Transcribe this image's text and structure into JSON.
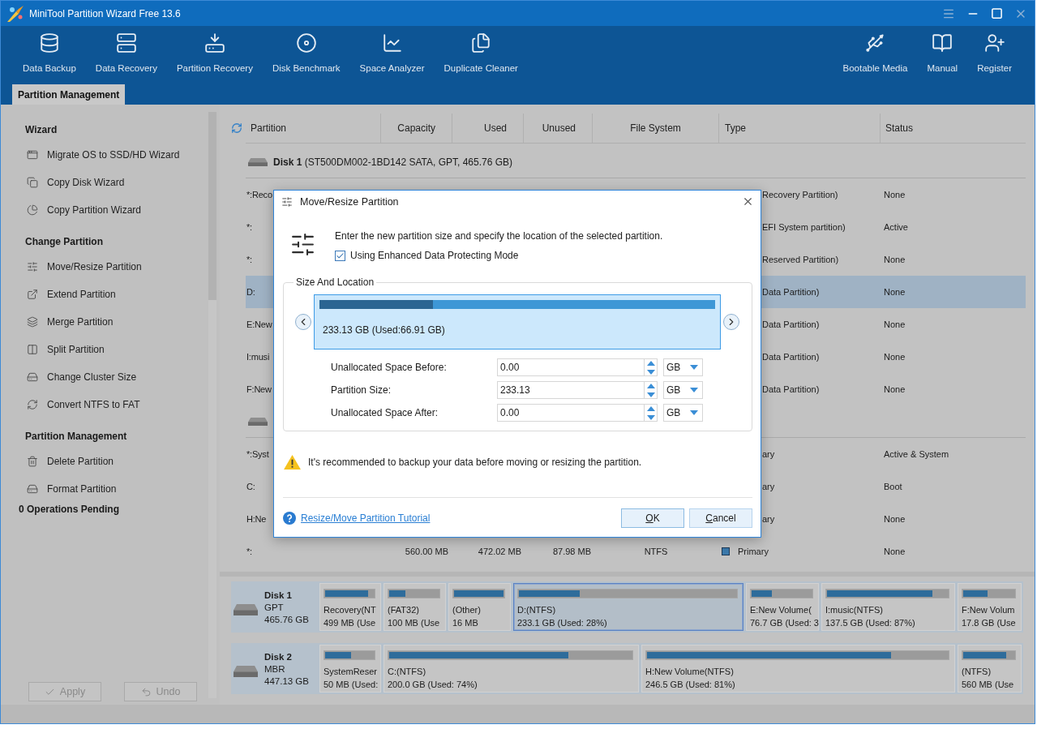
{
  "window": {
    "title": "MiniTool Partition Wizard Free 13.6"
  },
  "toolbar": {
    "left": [
      "Data Backup",
      "Data Recovery",
      "Partition Recovery",
      "Disk Benchmark",
      "Space Analyzer",
      "Duplicate Cleaner"
    ],
    "right": [
      "Bootable Media",
      "Manual",
      "Register"
    ]
  },
  "tabs": [
    {
      "label": "Partition Management",
      "selected": true
    }
  ],
  "sidebar": {
    "sections": [
      {
        "title": "Wizard",
        "items": [
          "Migrate OS to SSD/HD Wizard",
          "Copy Disk Wizard",
          "Copy Partition Wizard"
        ]
      },
      {
        "title": "Change Partition",
        "items": [
          "Move/Resize Partition",
          "Extend Partition",
          "Merge Partition",
          "Split Partition",
          "Change Cluster Size",
          "Convert NTFS to FAT"
        ]
      },
      {
        "title": "Partition Management",
        "items": [
          "Delete Partition",
          "Format Partition"
        ]
      }
    ],
    "pending": "0 Operations Pending",
    "buttons": [
      {
        "label": "Apply",
        "disabled": true
      },
      {
        "label": "Undo",
        "disabled": true
      }
    ]
  },
  "disk_table": {
    "columns": [
      "Partition",
      "Capacity",
      "Used",
      "Unused",
      "File System",
      "Type",
      "Status"
    ],
    "rows": [
      {
        "kind": "disk",
        "label": "**Disk 1** (ST500DM002-1BD142 SATA, GPT, 465.76 GB)",
        "selected": false
      },
      {
        "kind": "covered",
        "partition": "*:Reco",
        "type": "Recovery Partition)",
        "status": "None",
        "selected": false
      },
      {
        "kind": "covered",
        "partition": "*:",
        "type": "EFI System partition)",
        "status": "Active",
        "selected": false
      },
      {
        "kind": "covered",
        "partition": "*:",
        "type": "Reserved Partition)",
        "status": "None",
        "selected": false
      },
      {
        "kind": "covered",
        "partition": "D:",
        "type": "Data Partition)",
        "status": "None",
        "selected": true
      },
      {
        "kind": "covered",
        "partition": "E:New",
        "type": "Data Partition)",
        "status": "None",
        "selected": false
      },
      {
        "kind": "covered",
        "partition": "I:musi",
        "type": "Data Partition)",
        "status": "None",
        "selected": false
      },
      {
        "kind": "covered",
        "partition": "F:New",
        "type": "Data Partition)",
        "status": "None",
        "selected": false
      },
      {
        "kind": "disk",
        "selected": false
      },
      {
        "kind": "covered",
        "partition": "*:Syst",
        "type": "ary",
        "status": "Active & System",
        "selected": false
      },
      {
        "kind": "covered",
        "partition": "C:",
        "type": "ary",
        "status": "Boot",
        "selected": false
      },
      {
        "kind": "covered",
        "partition": "H:Ne",
        "type": "ary",
        "status": "None",
        "selected": false
      },
      {
        "kind": "partition",
        "partition": "*:",
        "capacity": "560.00 MB",
        "used": "472.02 MB",
        "unused": "87.98 MB",
        "file_system": "NTFS",
        "type": "Primary",
        "color": "#3a78aa",
        "status": "None",
        "selected": false
      }
    ]
  },
  "disk_map": {
    "disks": [
      {
        "name": "Disk 1",
        "scheme": "GPT",
        "size": "465.76 GB",
        "partitions": [
          {
            "label": "Recovery(NT",
            "detail": "499 MB (Use",
            "level": 0.88,
            "selected": false
          },
          {
            "label": "(FAT32)",
            "detail": "100 MB (Use",
            "level": 0.33,
            "selected": false
          },
          {
            "label": "(Other)",
            "detail": "16 MB",
            "level": 1,
            "selected": false
          },
          {
            "label": "D:(NTFS)",
            "detail": "233.1 GB (Used: 28%)",
            "level": 0.28,
            "selected": true
          },
          {
            "label": "E:New Volume(",
            "detail": "76.7 GB (Used: 3",
            "level": 0.34,
            "selected": false
          },
          {
            "label": "I:music(NTFS)",
            "detail": "137.5 GB (Used: 87%)",
            "level": 0.87,
            "selected": false
          },
          {
            "label": "F:New Volum",
            "detail": "17.8 GB (Use",
            "level": 0.47,
            "selected": false
          }
        ]
      },
      {
        "name": "Disk 2",
        "scheme": "MBR",
        "size": "447.13 GB",
        "partitions": [
          {
            "label": "SystemReser",
            "detail": "50 MB (Used:",
            "level": 0.53,
            "selected": false
          },
          {
            "label": "C:(NTFS)",
            "detail": "200.0 GB (Used: 74%)",
            "level": 0.74,
            "selected": false
          },
          {
            "label": "H:New Volume(NTFS)",
            "detail": "246.5 GB (Used: 81%)",
            "level": 0.81,
            "selected": false
          },
          {
            "label": "(NTFS)",
            "detail": "560 MB (Use",
            "level": 0.84,
            "selected": false
          }
        ]
      }
    ]
  },
  "dialog": {
    "title": "Move/Resize Partition",
    "instruction": "Enter the new partition size and specify the location of the selected partition.",
    "option": {
      "label": "Using Enhanced Data Protecting Mode",
      "checked": true
    },
    "group": "Size And Location",
    "partition": {
      "text": "233.13 GB (Used:66.91 GB)",
      "level": 0.287
    },
    "fields": [
      {
        "label": "Unallocated Space Before:",
        "value": "0.00",
        "unit": "GB"
      },
      {
        "label": "Partition Size:",
        "value": "233.13",
        "unit": "GB"
      },
      {
        "label": "Unallocated Space After:",
        "value": "0.00",
        "unit": "GB"
      }
    ],
    "warning": "It's recommended to backup your data before moving or resizing the partition.",
    "link": "Resize/Move Partition Tutorial",
    "buttons": [
      "OK",
      "Cancel"
    ]
  }
}
